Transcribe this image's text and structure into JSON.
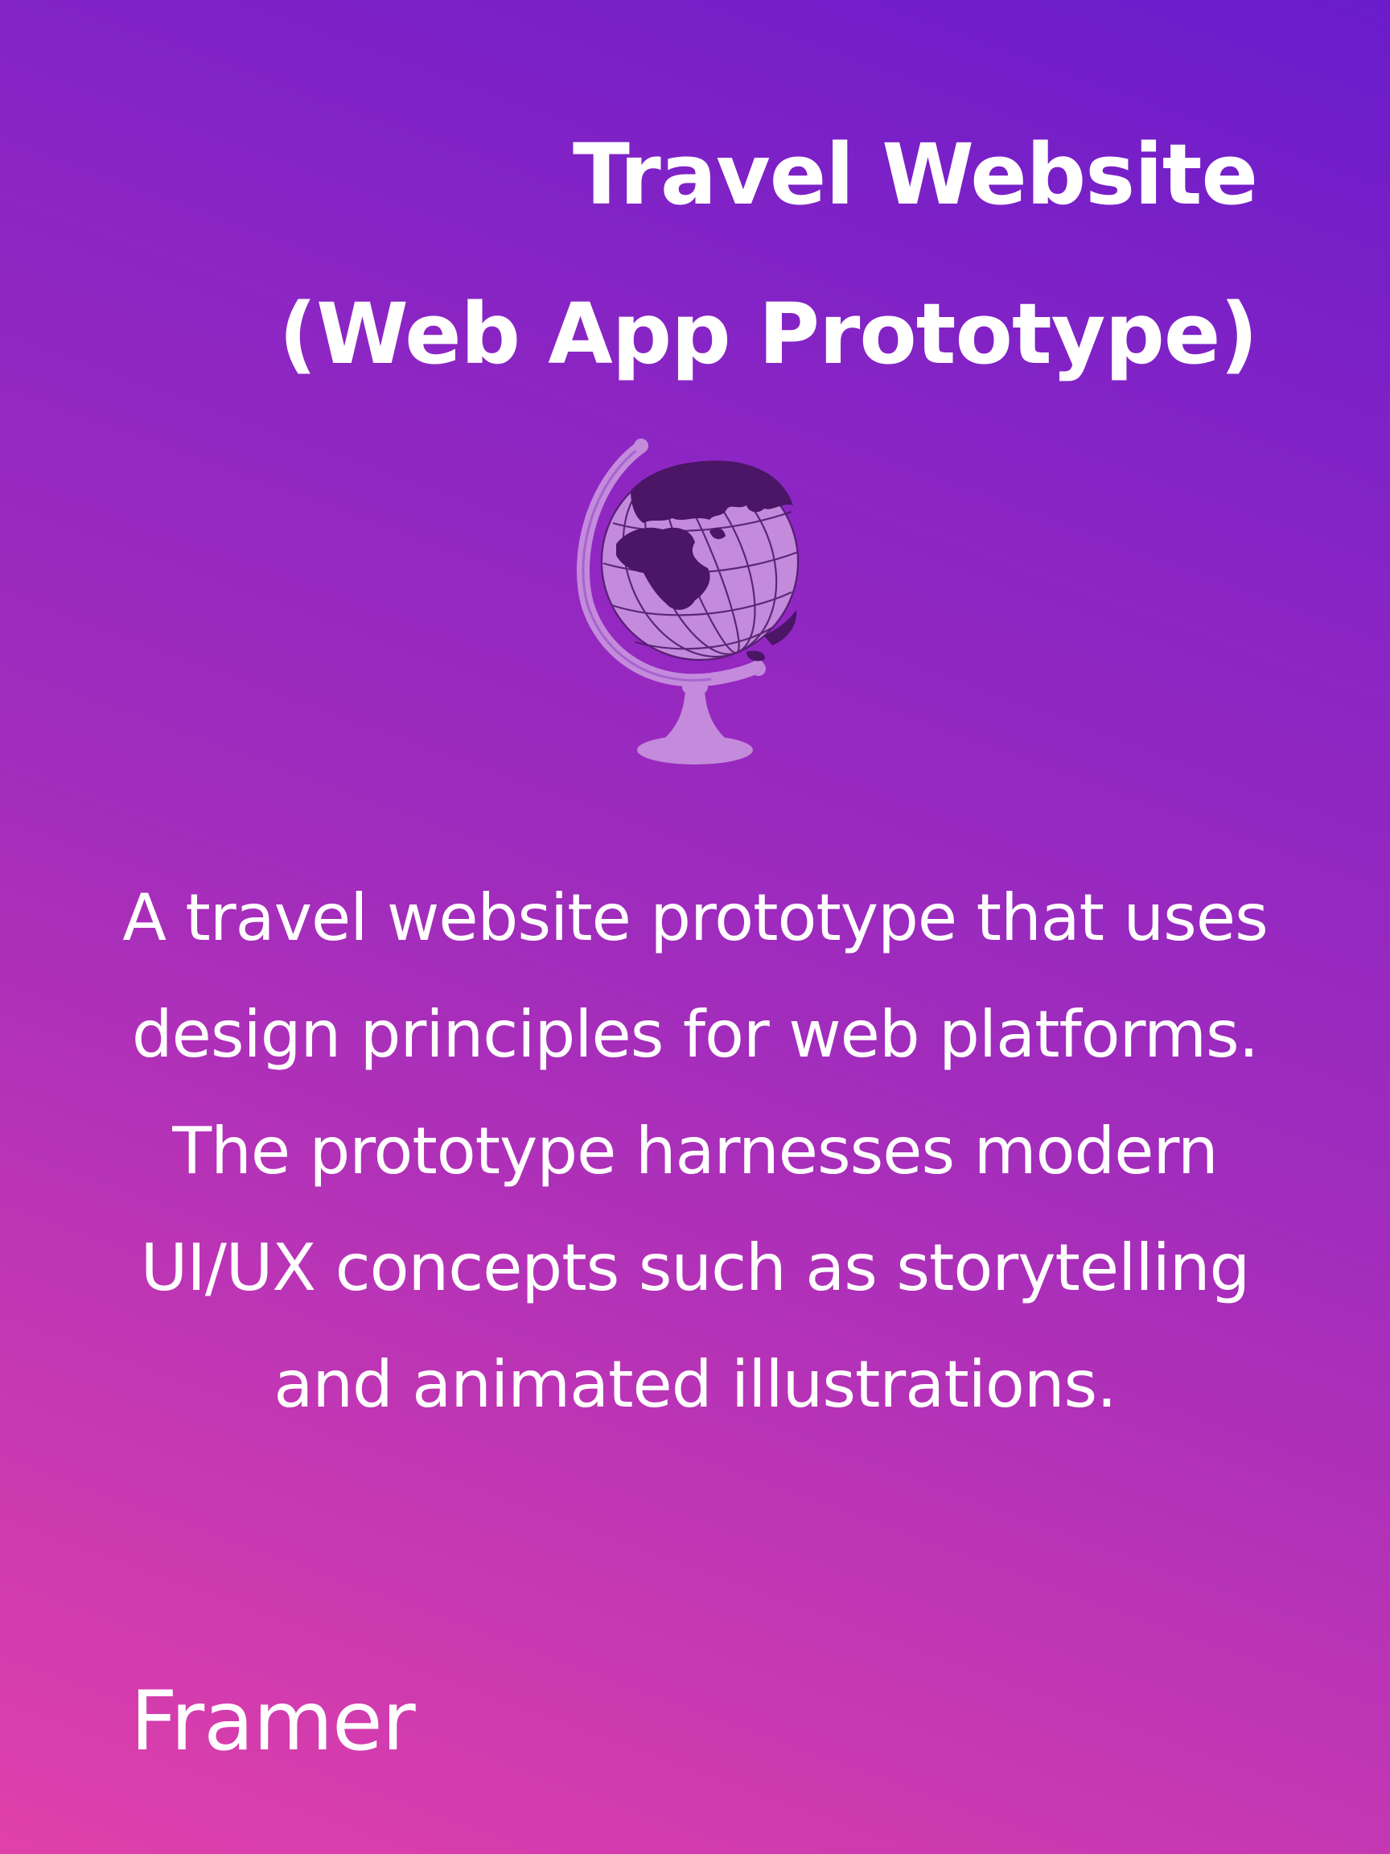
{
  "card": {
    "title_line_1": "Travel Website",
    "title_line_2": "(Web App Prototype)",
    "illustration_icon": "globe-icon",
    "description": "A travel website prototype that uses design principles for web platforms. The prototype harnesses modern UI/UX concepts such as storytelling and animated illustrations.",
    "tool": "Framer"
  },
  "colors": {
    "gradient_top": "#6a1ccb",
    "gradient_bottom": "#e040aa",
    "text": "#ffffff",
    "globe_light": "#c48bdc",
    "globe_dark": "#4a1665"
  }
}
